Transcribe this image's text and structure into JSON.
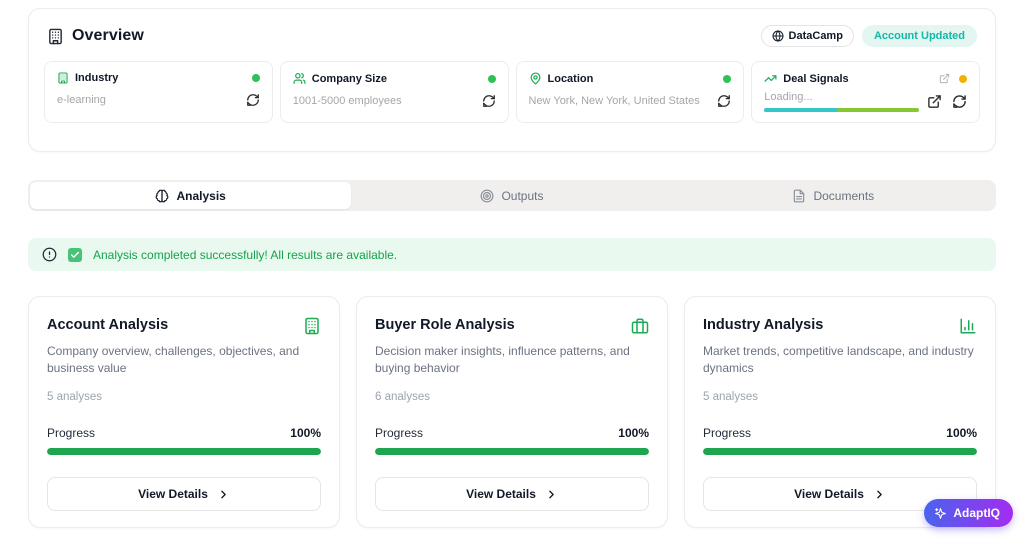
{
  "header": {
    "title": "Overview",
    "badges": {
      "datacamp": "DataCamp",
      "account_updated": "Account Updated"
    }
  },
  "info_cards": [
    {
      "label": "Industry",
      "value": "e-learning",
      "icon": "building-icon",
      "status": "green"
    },
    {
      "label": "Company Size",
      "value": "1001-5000 employees",
      "icon": "users-icon",
      "status": "green"
    },
    {
      "label": "Location",
      "value": "New York, New York, United States",
      "icon": "map-pin-icon",
      "status": "green"
    },
    {
      "label": "Deal Signals",
      "value": "Loading...",
      "icon": "trending-up-icon",
      "status": "yellow",
      "loading_teal_pct": 47,
      "loading_lime_pct": 53
    }
  ],
  "tabs": [
    {
      "label": "Analysis",
      "icon": "brain-icon",
      "active": true
    },
    {
      "label": "Outputs",
      "icon": "target-icon",
      "active": false
    },
    {
      "label": "Documents",
      "icon": "document-icon",
      "active": false
    }
  ],
  "alert": {
    "message": "Analysis completed successfully! All results are available."
  },
  "analysis_cards": [
    {
      "title": "Account Analysis",
      "description": "Company overview, challenges, objectives, and business value",
      "count": "5 analyses",
      "progress_label": "Progress",
      "progress_value": "100%",
      "progress_pct": 100,
      "button_label": "View Details",
      "icon": "building-icon"
    },
    {
      "title": "Buyer Role Analysis",
      "description": "Decision maker insights, influence patterns, and buying behavior",
      "count": "6 analyses",
      "progress_label": "Progress",
      "progress_value": "100%",
      "progress_pct": 100,
      "button_label": "View Details",
      "icon": "briefcase-icon"
    },
    {
      "title": "Industry Analysis",
      "description": "Market trends, competitive landscape, and industry dynamics",
      "count": "5 analyses",
      "progress_label": "Progress",
      "progress_value": "100%",
      "progress_pct": 100,
      "button_label": "View Details",
      "icon": "bar-chart-icon"
    }
  ],
  "fab": {
    "label": "AdaptIQ"
  },
  "colors": {
    "accent_green": "#1da64e",
    "icon_green": "#1cab54",
    "status_green": "#2fc158",
    "status_yellow": "#f0b100",
    "teal_badge_text": "#14b8a6",
    "teal_badge_bg": "#e3f6f2",
    "alert_bg": "#e9f9ef",
    "alert_text": "#16a34a",
    "deal_teal": "#36c5c9",
    "deal_lime": "#85c832",
    "fab_gradient_start": "#4a63ee",
    "fab_gradient_end": "#a32cf0"
  }
}
